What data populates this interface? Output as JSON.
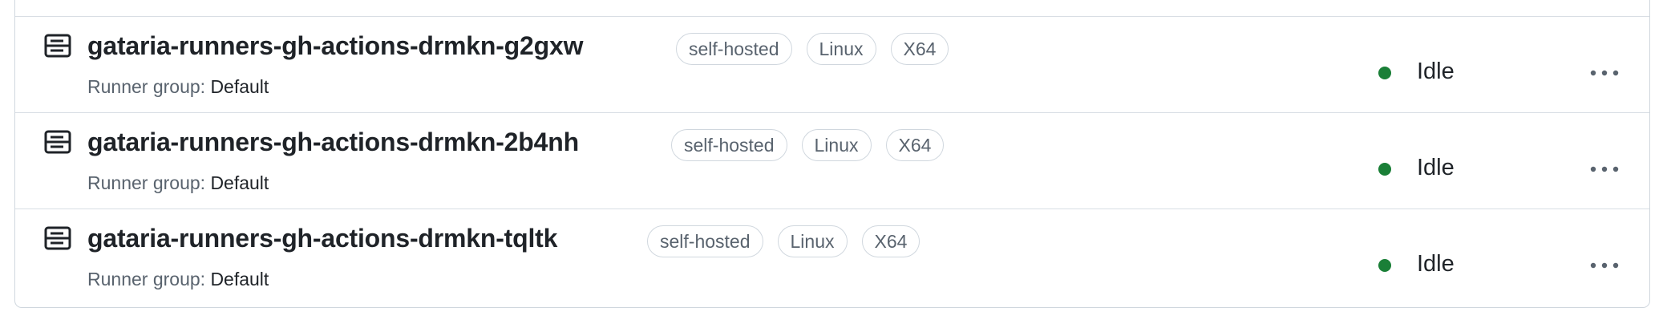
{
  "runners": [
    {
      "name": "gataria-runners-gh-actions-drmkn-g2gxw",
      "labels": [
        "self-hosted",
        "Linux",
        "X64"
      ],
      "group_label": "Runner group:",
      "group_value": "Default",
      "status": "Idle"
    },
    {
      "name": "gataria-runners-gh-actions-drmkn-2b4nh",
      "labels": [
        "self-hosted",
        "Linux",
        "X64"
      ],
      "group_label": "Runner group:",
      "group_value": "Default",
      "status": "Idle"
    },
    {
      "name": "gataria-runners-gh-actions-drmkn-tqltk",
      "labels": [
        "self-hosted",
        "Linux",
        "X64"
      ],
      "group_label": "Runner group:",
      "group_value": "Default",
      "status": "Idle"
    }
  ],
  "colors": {
    "status_idle": "#1a7f37",
    "border": "#d0d7de",
    "muted_text": "#59636e"
  },
  "icons": {
    "runner": "server-icon",
    "menu": "kebab-horizontal-icon",
    "status": "status-dot-icon"
  }
}
